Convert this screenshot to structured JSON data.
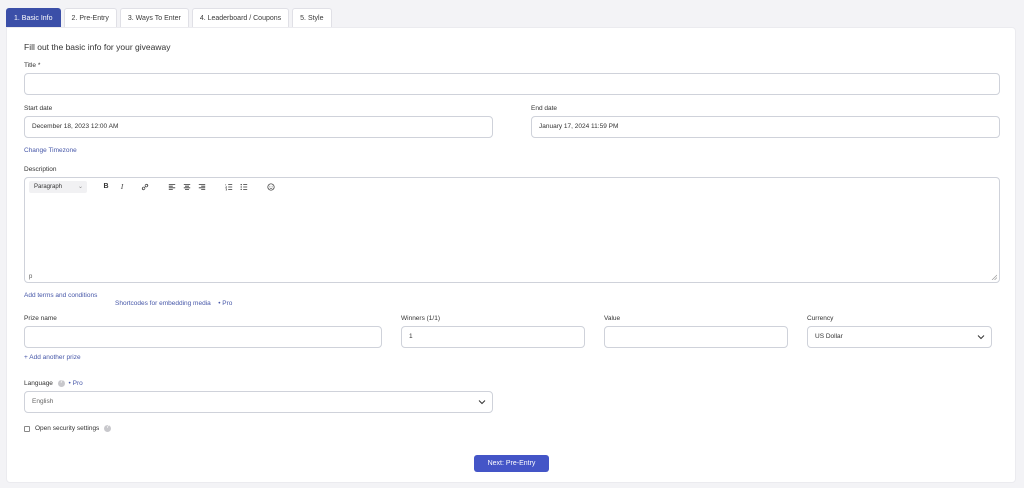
{
  "tabs": [
    {
      "label": "1. Basic Info",
      "active": true
    },
    {
      "label": "2. Pre-Entry",
      "active": false
    },
    {
      "label": "3. Ways To Enter",
      "active": false
    },
    {
      "label": "4. Leaderboard / Coupons",
      "active": false
    },
    {
      "label": "5. Style",
      "active": false
    }
  ],
  "form": {
    "heading": "Fill out the basic info for your giveaway",
    "title_label": "Title",
    "title_required": "*",
    "title_value": "",
    "start_label": "Start date",
    "start_value": "December 18, 2023 12:00 AM",
    "end_label": "End date",
    "end_value": "January 17, 2024 11:59 PM",
    "change_timezone": "Change Timezone",
    "description_label": "Description",
    "editor": {
      "format": "Paragraph",
      "status_path": "p",
      "icons": [
        "bold-icon",
        "italic-icon",
        "link-icon",
        "align-left-icon",
        "align-center-icon",
        "align-right-icon",
        "ordered-list-icon",
        "bullet-list-icon",
        "emoji-icon"
      ]
    },
    "add_terms": "Add terms and conditions",
    "shortcodes": "Shortcodes for embedding media",
    "pro_tag": "• Pro",
    "prize_name_label": "Prize name",
    "prize_name_value": "",
    "winners_label": "Winners (1/1)",
    "winners_value": "1",
    "value_label": "Value",
    "value_value": "",
    "currency_label": "Currency",
    "currency_value": "US Dollar",
    "add_prize": "+ Add another prize",
    "language_label": "Language",
    "language_value": "English",
    "security_label": "Open security settings",
    "next_button": "Next: Pre-Entry"
  },
  "colors": {
    "accent": "#3b4fa8",
    "button": "#4455c7",
    "link": "#4657a8"
  }
}
